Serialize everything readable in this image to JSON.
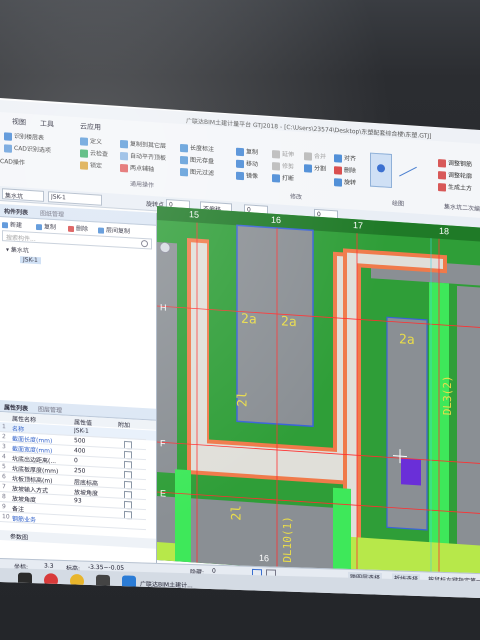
{
  "titlebar": {
    "text": "广联达BIM土建计量平台 GTJ2018 - [C:\\Users\\23574\\Desktop\\东塑配套综合楼\\东塑.GTJ]"
  },
  "ribbon": {
    "tabs": [
      "视图",
      "工具",
      "云应用"
    ],
    "groups": [
      {
        "name": "通用操作",
        "items": [
          "定义",
          "云检查",
          "锁定",
          "复制到其它层",
          "自动平齐顶板",
          "两点辅轴",
          "长度标注",
          "图元存盘",
          "图元过滤"
        ]
      },
      {
        "name": "修改",
        "items": [
          "复制",
          "移动",
          "镜像",
          "延伸",
          "修剪",
          "打断",
          "合并",
          "分割",
          "对齐",
          "删除",
          "旋转",
          "偏移"
        ]
      },
      {
        "name": "绘图",
        "items": []
      }
    ],
    "left_items": [
      "识别楼层表",
      "CAD识别选项",
      "CAD操作"
    ],
    "right_items": [
      "调整钢筋",
      "调整轮廓",
      "生成土方"
    ],
    "right_group": "集水坑二次编辑"
  },
  "selectors": {
    "layer": "集水坑",
    "component": "JSK-1",
    "angle_label": "旋转点",
    "angle": "0",
    "mode": "不偏移",
    "x": "0",
    "y": "0"
  },
  "component_list": {
    "tabs": [
      "构件列表",
      "图纸管理"
    ],
    "toolbar": [
      "新建",
      "复制",
      "删除",
      "层间复制"
    ],
    "search_placeholder": "搜索构件...",
    "tree_root": "集水坑",
    "tree_child": "JSK-1"
  },
  "property_panel": {
    "tabs": [
      "属性列表",
      "图层管理"
    ],
    "columns": [
      "属性名称",
      "属性值",
      "附加"
    ],
    "rows": [
      {
        "n": "1",
        "name": "名称",
        "value": "JSK-1"
      },
      {
        "n": "2",
        "name": "截面长度(mm)",
        "value": "500"
      },
      {
        "n": "3",
        "name": "截面宽度(mm)",
        "value": "400"
      },
      {
        "n": "4",
        "name": "坑底出边距离(...",
        "value": "0"
      },
      {
        "n": "5",
        "name": "坑底板厚度(mm)",
        "value": "250"
      },
      {
        "n": "6",
        "name": "坑板顶标高(m)",
        "value": "层底标高"
      },
      {
        "n": "7",
        "name": "放坡输入方式",
        "value": "放坡角度"
      },
      {
        "n": "8",
        "name": "放坡角度",
        "value": "93"
      },
      {
        "n": "9",
        "name": "备注",
        "value": ""
      },
      {
        "n": "10",
        "name": "钢筋业务",
        "value": ""
      }
    ],
    "footer_button": "参数图"
  },
  "canvas": {
    "axis_top": [
      "15",
      "16",
      "17",
      "18"
    ],
    "axis_left": [
      "H",
      "F",
      "E"
    ],
    "axis_bottom": [
      "16"
    ],
    "cad_labels": [
      "2a",
      "2a",
      "2a",
      "2l",
      "2l",
      "DL3(2)",
      "DL10(1)"
    ],
    "colors": {
      "bg": "#2f9e38",
      "slab": "#8a8f94",
      "wall": "#e0dfd9",
      "edge": "#f07a4a",
      "beam": "#3ee85a",
      "pit": "#6a2fd8",
      "blueline": "#3a63d8"
    }
  },
  "statusbar": {
    "coord_x_label": "坐标:",
    "coord_x": "3.3",
    "elev_label": "标高:",
    "elev": "-3.35~-0.05",
    "hidden_label": "隐藏:",
    "hidden": "0",
    "btn1": "跨图层选择",
    "btn2": "折线选择",
    "btn3": "按鼠标左键指定第一个"
  },
  "taskbar": {
    "app_label": "广联达BIM土建计..."
  }
}
